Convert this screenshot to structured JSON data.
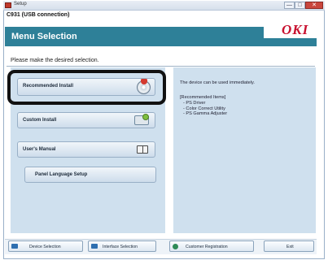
{
  "window": {
    "title": "Setup",
    "min_glyph": "—",
    "max_glyph": "□",
    "close_glyph": "✕"
  },
  "model": "C931 (USB connection)",
  "header": {
    "title": "Menu Selection",
    "logo": "OKI",
    "brand_color": "#2e8098",
    "logo_color": "#c8102e"
  },
  "prompt": "Please make the desired selection.",
  "menu": {
    "items": [
      {
        "label": "Recommended Install",
        "icon": "install-disc-icon",
        "highlighted": true
      },
      {
        "label": "Custom Install",
        "icon": "custom-settings-icon"
      },
      {
        "label": "User's Manual",
        "icon": "manual-book-icon"
      },
      {
        "label": "Panel Language Setup"
      }
    ]
  },
  "info": {
    "main": "The device can be used immediately.",
    "heading": "[Recommended Items]",
    "items": [
      "- PS Driver",
      "- Color Correct Utility",
      "- PS Gamma Adjuster"
    ]
  },
  "footer": {
    "buttons": [
      {
        "label": "Device Selection",
        "icon": "back-arrow-icon"
      },
      {
        "label": "Interface Selection",
        "icon": "back-arrow-icon"
      },
      {
        "label": "Customer Registration",
        "icon": "registration-icon"
      },
      {
        "label": "Exit"
      }
    ]
  }
}
